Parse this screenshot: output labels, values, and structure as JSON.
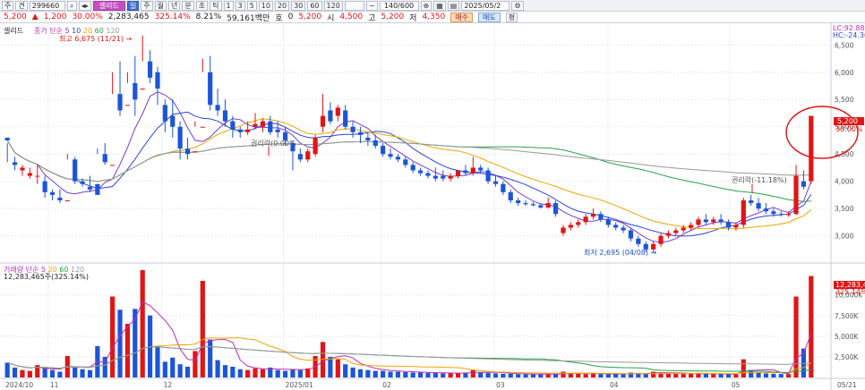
{
  "toolbar": {
    "mode": "주",
    "type": "견",
    "code": "299660",
    "name": "셀리드",
    "periods": [
      "주",
      "월",
      "년",
      "분",
      "초",
      "틱"
    ],
    "minutes": [
      "1",
      "3",
      "5",
      "10",
      "20",
      "30",
      "60",
      "120"
    ],
    "count": "140/600",
    "date": "2025/05/2"
  },
  "quote": {
    "price": "5,200",
    "arrow": "▲",
    "change": "1,200",
    "rate": "30.00%",
    "volume": "2,283,465",
    "vol_rate": "325.14%",
    "turnover": "8.21%",
    "amount": "59,161백만",
    "ho_label": "호",
    "ho_value": "0",
    "price2": "5,200",
    "open_label": "시",
    "open": "4,500",
    "high_label": "고",
    "high": "5,200",
    "low_label": "저",
    "low": "4,350",
    "buy_label": "매수",
    "sell_label": "매도",
    "settings_label": "평"
  },
  "price_panel": {
    "name_label": "셀리드",
    "ma_legend": [
      "종가 단순",
      "5",
      "10",
      "20",
      "60",
      "120"
    ],
    "ma_colors": [
      "#c02ab8",
      "#7a3ad1",
      "#2a45d8",
      "#f0a400",
      "#28a04a",
      "#999999"
    ],
    "high_note": "최고 6,675 (11/21)",
    "low_note": "최저 2,695 (04/08)",
    "rights_note_left": "권리락(0.00%",
    "rights_note_right": "권리락(-11.18%)",
    "lc": "LC:92.88",
    "hc": "HC:-24.36",
    "current_price": "5,200",
    "current_rate": "30.00%",
    "y_ticks": [
      "6,500",
      "6,000",
      "5,500",
      "5,000",
      "4,500",
      "4,000",
      "3,500",
      "3,000"
    ]
  },
  "volume_panel": {
    "legend": [
      "거래량 단순",
      "5",
      "20",
      "60",
      "120"
    ],
    "legend_colors": [
      "#c02ab8",
      "#f0a400",
      "#28a04a",
      "#999999"
    ],
    "summary": "12,283,465주(325.14%)",
    "current_volume": "12,283,465",
    "current_rate": "325.14%",
    "y_ticks": [
      "10,000K",
      "7,500K",
      "5,000K",
      "2,500K"
    ]
  },
  "x_axis": [
    "2024/10",
    "11",
    "12",
    "2025/01",
    "02",
    "03",
    "04",
    "05",
    "05/21"
  ],
  "chart_data": {
    "type": "candlestick",
    "y_range": [
      2600,
      6800
    ],
    "volume_range_k": [
      0,
      13000
    ],
    "candles": [
      [
        4800,
        4700,
        4750,
        4350
      ],
      [
        4350,
        4450,
        4300,
        4200
      ],
      [
        4200,
        4300,
        4250,
        4100
      ],
      [
        4100,
        4250,
        4150,
        4050
      ],
      [
        4100,
        4300,
        4100,
        3950
      ],
      [
        4000,
        4100,
        3800,
        3700
      ],
      [
        3800,
        3850,
        3750,
        3650
      ],
      [
        3700,
        3850,
        3650,
        3600
      ],
      [
        3650,
        4500,
        3650,
        4400
      ],
      [
        4400,
        4450,
        4000,
        3950
      ],
      [
        4000,
        4050,
        3950,
        3900
      ],
      [
        3900,
        4100,
        3850,
        3800
      ],
      [
        3950,
        4600,
        3750,
        4500
      ],
      [
        4500,
        4700,
        4350,
        4300
      ],
      [
        4300,
        6000,
        4300,
        5600
      ],
      [
        5600,
        6200,
        5300,
        5200
      ],
      [
        5400,
        6000,
        5400,
        5800
      ],
      [
        5800,
        6300,
        5500,
        5200
      ],
      [
        5700,
        6675,
        5700,
        6200
      ],
      [
        6200,
        6400,
        5900,
        5800
      ],
      [
        6000,
        6100,
        5700,
        5400
      ],
      [
        5400,
        5500,
        5100,
        4900
      ],
      [
        5200,
        5500,
        5000,
        4800
      ],
      [
        5000,
        5100,
        4600,
        4400
      ],
      [
        4600,
        4800,
        4500,
        4400
      ],
      [
        4550,
        5100,
        4550,
        5000
      ],
      [
        5000,
        6250,
        5000,
        6000
      ],
      [
        6000,
        6300,
        5400,
        5300
      ],
      [
        5400,
        5700,
        5300,
        5200
      ],
      [
        5300,
        5500,
        5100,
        5000
      ],
      [
        5100,
        5200,
        4950,
        4800
      ],
      [
        4950,
        5000,
        4900,
        4800
      ],
      [
        4900,
        5100,
        4950,
        4850
      ],
      [
        5000,
        5250,
        5050,
        4950
      ],
      [
        5000,
        5150,
        5100,
        4900
      ],
      [
        5100,
        5200,
        4900,
        4850
      ],
      [
        4950,
        5100,
        4900,
        4800
      ],
      [
        4900,
        5000,
        4750,
        4650
      ],
      [
        4700,
        4750,
        4550,
        4200
      ],
      [
        4500,
        4600,
        4400,
        4350
      ],
      [
        4400,
        4600,
        4550,
        4350
      ],
      [
        4500,
        4850,
        4800,
        4450
      ],
      [
        5000,
        5600,
        5200,
        4900
      ],
      [
        5300,
        5450,
        5100,
        5050
      ],
      [
        5200,
        5400,
        5350,
        5100
      ],
      [
        5300,
        5400,
        5000,
        4950
      ],
      [
        5000,
        5100,
        4900,
        4800
      ],
      [
        4900,
        5000,
        4850,
        4700
      ],
      [
        4800,
        4900,
        4750,
        4650
      ],
      [
        4750,
        4850,
        4650,
        4600
      ],
      [
        4650,
        4700,
        4500,
        4450
      ],
      [
        4500,
        4600,
        4450,
        4400
      ],
      [
        4450,
        4500,
        4400,
        4350
      ],
      [
        4400,
        4450,
        4300,
        4250
      ],
      [
        4300,
        4350,
        4200,
        4150
      ],
      [
        4200,
        4250,
        4150,
        4100
      ],
      [
        4150,
        4200,
        4100,
        4050
      ],
      [
        4100,
        4250,
        4050,
        4000
      ],
      [
        4100,
        4200,
        4050,
        4000
      ],
      [
        4050,
        4150,
        4100,
        4000
      ],
      [
        4100,
        4200,
        4200,
        4050
      ],
      [
        4200,
        4300,
        4150,
        4100
      ],
      [
        4150,
        4450,
        4250,
        4100
      ],
      [
        4250,
        4300,
        4200,
        4150
      ],
      [
        4200,
        4250,
        4000,
        3950
      ],
      [
        4000,
        4100,
        3950,
        3900
      ],
      [
        3950,
        4000,
        3800,
        3750
      ],
      [
        3800,
        3850,
        3650,
        3600
      ],
      [
        3650,
        3700,
        3600,
        3550
      ],
      [
        3600,
        3650,
        3580,
        3550
      ],
      [
        3580,
        3620,
        3560,
        3540
      ],
      [
        3560,
        3600,
        3520,
        3500
      ],
      [
        3520,
        3700,
        3600,
        3500
      ],
      [
        3600,
        3650,
        3400,
        3350
      ],
      [
        3050,
        3200,
        3150,
        3000
      ],
      [
        3150,
        3250,
        3200,
        3100
      ],
      [
        3200,
        3300,
        3250,
        3150
      ],
      [
        3250,
        3400,
        3350,
        3200
      ],
      [
        3350,
        3500,
        3400,
        3300
      ],
      [
        3400,
        3450,
        3300,
        3250
      ],
      [
        3300,
        3350,
        3200,
        3150
      ],
      [
        3200,
        3250,
        3150,
        3100
      ],
      [
        3150,
        3200,
        3100,
        3050
      ],
      [
        3100,
        3150,
        2950,
        2900
      ],
      [
        2950,
        3000,
        2850,
        2800
      ],
      [
        2850,
        2900,
        2750,
        2700
      ],
      [
        2750,
        2900,
        2850,
        2695
      ],
      [
        2850,
        3050,
        3000,
        2800
      ],
      [
        3000,
        3100,
        3050,
        2950
      ],
      [
        3050,
        3150,
        3100,
        3000
      ],
      [
        3100,
        3200,
        3150,
        3050
      ],
      [
        3150,
        3250,
        3200,
        3100
      ],
      [
        3200,
        3350,
        3300,
        3150
      ],
      [
        3300,
        3400,
        3250,
        3200
      ],
      [
        3250,
        3350,
        3300,
        3200
      ],
      [
        3300,
        3400,
        3250,
        3200
      ],
      [
        3250,
        3300,
        3150,
        3100
      ],
      [
        3150,
        3250,
        3200,
        3100
      ],
      [
        3200,
        3700,
        3650,
        3150
      ],
      [
        3650,
        3750,
        3600,
        3550
      ],
      [
        3600,
        3700,
        3500,
        3450
      ],
      [
        3500,
        3600,
        3450,
        3400
      ],
      [
        3450,
        3500,
        3400,
        3350
      ],
      [
        3400,
        3450,
        3380,
        3350
      ],
      [
        3380,
        3450,
        3400,
        3350
      ],
      [
        3400,
        4300,
        4100,
        3380
      ],
      [
        4000,
        4200,
        3900,
        3850
      ],
      [
        4000,
        4500,
        5200,
        3950
      ]
    ],
    "volumes_k": [
      1800,
      1200,
      900,
      800,
      1500,
      1100,
      900,
      700,
      2600,
      1200,
      1000,
      900,
      3800,
      2500,
      9800,
      8200,
      6500,
      8300,
      13000,
      7500,
      3800,
      1900,
      2400,
      1600,
      1300,
      3200,
      11700,
      4600,
      2100,
      1500,
      1300,
      1000,
      900,
      1100,
      1000,
      1200,
      900,
      800,
      1000,
      900,
      1100,
      2600,
      4300,
      2500,
      2200,
      1600,
      1200,
      1000,
      900,
      800,
      800,
      700,
      700,
      650,
      600,
      600,
      550,
      550,
      500,
      500,
      550,
      600,
      900,
      600,
      550,
      500,
      450,
      450,
      400,
      400,
      380,
      380,
      450,
      420,
      700,
      500,
      450,
      420,
      500,
      450,
      400,
      380,
      380,
      600,
      550,
      500,
      700,
      600,
      500,
      450,
      450,
      450,
      500,
      450,
      420,
      420,
      400,
      380,
      2200,
      900,
      600,
      500,
      450,
      420,
      420,
      9800,
      3500,
      12283
    ]
  }
}
